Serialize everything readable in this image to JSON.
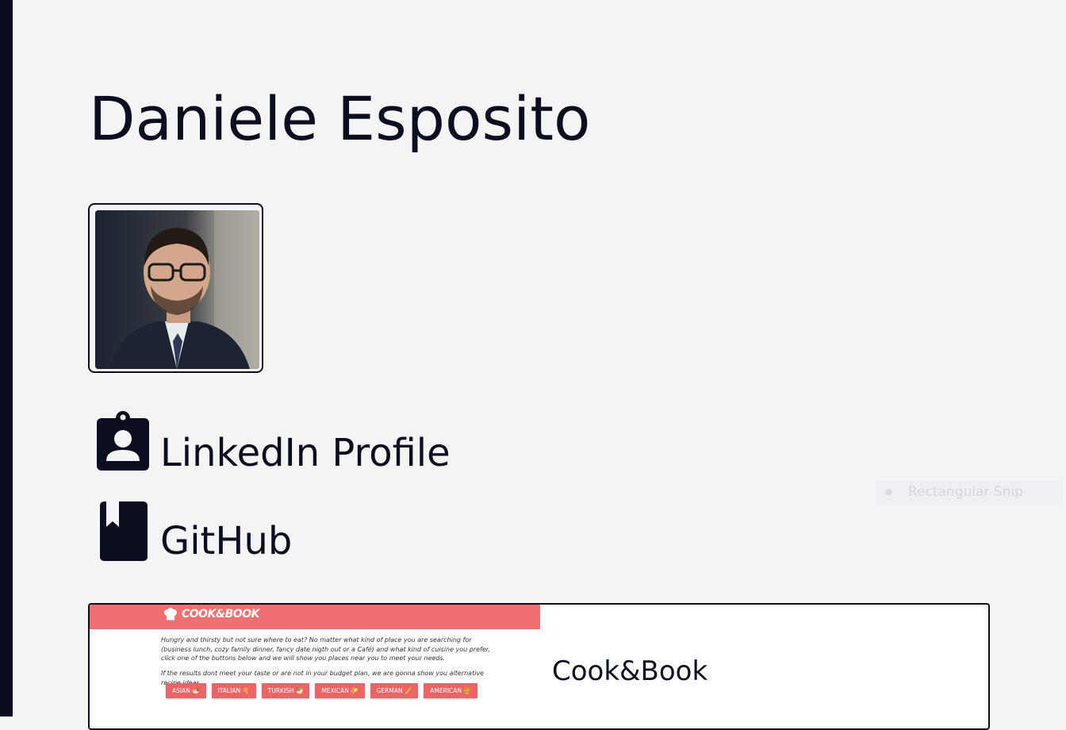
{
  "profile": {
    "name": "Daniele Esposito"
  },
  "links": [
    {
      "label": "LinkedIn Profile",
      "icon": "contact-badge-icon"
    },
    {
      "label": "GitHub",
      "icon": "book-bookmark-icon"
    }
  ],
  "overlay": {
    "snip_label": "Rectangular Snip"
  },
  "projects": [
    {
      "title": "Cook&Book",
      "preview": {
        "logo": "COOK&BOOK",
        "intro": "Hungry and thirsty but not sure where to eat? No matter what kind of place you are searching for (business lunch, cozy family dinner, fancy date nigth out or a Café) and what kind of cuisine you prefer, click one of the buttons below and we will show you places near you to meet your needs.",
        "note": "If the results dont meet your taste or are not in your budget plan, we are gonna show you alternative recipe ideas.",
        "buttons": [
          "ASIAN 🍜",
          "ITALIAN 🍕",
          "TURKISH 🥙",
          "MEXICAN 🌮",
          "GERMAN 🥖",
          "AMERICAN 🍔"
        ]
      }
    }
  ],
  "colors": {
    "ink": "#0d0d22",
    "background": "#f4f4f5",
    "preview_accent": "#f06f71"
  }
}
